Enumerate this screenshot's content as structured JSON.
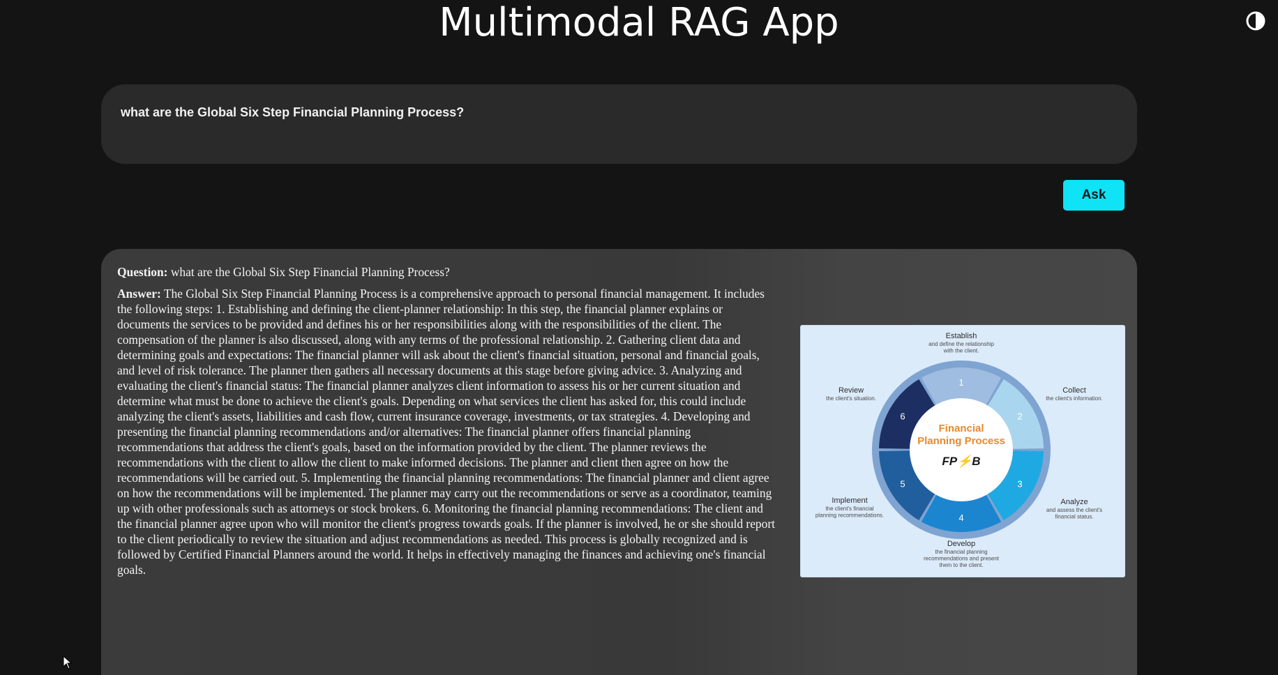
{
  "app": {
    "title": "Multimodal RAG App"
  },
  "query": {
    "value": "what are the Global Six Step Financial Planning Process?"
  },
  "ask_button": {
    "label": "Ask"
  },
  "result": {
    "question_label": "Question:",
    "question_text": "what are the Global Six Step Financial Planning Process?",
    "answer_label": "Answer:",
    "answer_text": "The Global Six Step Financial Planning Process is a comprehensive approach to personal financial management. It includes the following steps: 1. Establishing and defining the client-planner relationship: In this step, the financial planner explains or documents the services to be provided and defines his or her responsibilities along with the responsibilities of the client. The compensation of the planner is also discussed, along with any terms of the professional relationship. 2. Gathering client data and determining goals and expectations: The financial planner will ask about the client's financial situation, personal and financial goals, and level of risk tolerance. The planner then gathers all necessary documents at this stage before giving advice. 3. Analyzing and evaluating the client's financial status: The financial planner analyzes client information to assess his or her current situation and determine what must be done to achieve the client's goals. Depending on what services the client has asked for, this could include analyzing the client's assets, liabilities and cash flow, current insurance coverage, investments, or tax strategies. 4. Developing and presenting the financial planning recommendations and/or alternatives: The financial planner offers financial planning recommendations that address the client's goals, based on the information provided by the client. The planner reviews the recommendations with the client to allow the client to make informed decisions. The planner and client then agree on how the recommendations will be carried out. 5. Implementing the financial planning recommendations: The financial planner and client agree on how the recommendations will be implemented. The planner may carry out the recommendations or serve as a coordinator, teaming up with other professionals such as attorneys or stock brokers. 6. Monitoring the financial planning recommendations: The client and the financial planner agree upon who will monitor the client's progress towards goals. If the planner is involved, he or she should report to the client periodically to review the situation and adjust recommendations as needed. This process is globally recognized and is followed by Certified Financial Planners around the world. It helps in effectively managing the finances and achieving one's financial goals."
  },
  "diagram": {
    "center_title_line1": "Financial",
    "center_title_line2": "Planning Process",
    "logo": "FP⚡B",
    "steps": [
      {
        "number": "1",
        "title": "Establish",
        "desc1": "and define the relationship",
        "desc2": "with the client.",
        "desc3": "",
        "color": "#9fbde0"
      },
      {
        "number": "2",
        "title": "Collect",
        "desc1": "the client's information.",
        "desc2": "",
        "desc3": "",
        "color": "#a9d6ee"
      },
      {
        "number": "3",
        "title": "Analyze",
        "desc1": "and assess the client's",
        "desc2": "financial status.",
        "desc3": "",
        "color": "#1fa9e3"
      },
      {
        "number": "4",
        "title": "Develop",
        "desc1": "the financial planning",
        "desc2": "recommendations and present",
        "desc3": "them to the client.",
        "color": "#1b86cf"
      },
      {
        "number": "5",
        "title": "Implement",
        "desc1": "the client's financial",
        "desc2": "planning recommendations.",
        "desc3": "",
        "color": "#215e9e"
      },
      {
        "number": "6",
        "title": "Review",
        "desc1": "the client's situation.",
        "desc2": "",
        "desc3": "",
        "color": "#1d2e63"
      }
    ],
    "colors": {
      "center_title": "#e8892e",
      "ring_outer": "#7fa4d2",
      "background": "#dcebfa"
    }
  },
  "colors": {
    "background": "#141414",
    "query_box": "#2a2a2a",
    "ask_button": "#0fe3f5",
    "panel": "#3b3b3b"
  },
  "icons": {
    "theme_toggle": "half-circle-contrast-icon",
    "cursor": "mouse-pointer-icon"
  }
}
